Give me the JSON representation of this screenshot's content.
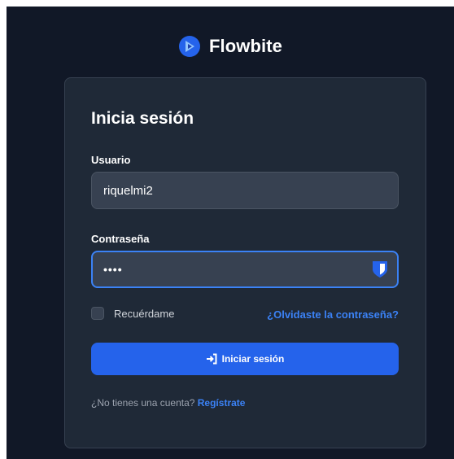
{
  "brand": {
    "name": "Flowbite",
    "logo_icon": "flowbite-logo-icon",
    "accent": "#2563eb"
  },
  "login": {
    "title": "Inicia sesión",
    "username": {
      "label": "Usuario",
      "value": "riquelmi2"
    },
    "password": {
      "label": "Contraseña",
      "masked_value": "••••",
      "manager_icon": "bitwarden-shield-icon"
    },
    "remember": {
      "label": "Recuérdame",
      "checked": false
    },
    "forgot_link": "¿Olvidaste la contraseña?",
    "submit": {
      "label": "Iniciar sesión",
      "icon": "login-arrow-icon"
    },
    "signup": {
      "prompt": "¿No tienes una cuenta?",
      "link": "Regístrate"
    }
  },
  "colors": {
    "page_bg": "#111827",
    "card_bg": "#1f2937",
    "input_bg": "#374151",
    "focus_border": "#3b82f6",
    "link": "#3b82f6"
  }
}
